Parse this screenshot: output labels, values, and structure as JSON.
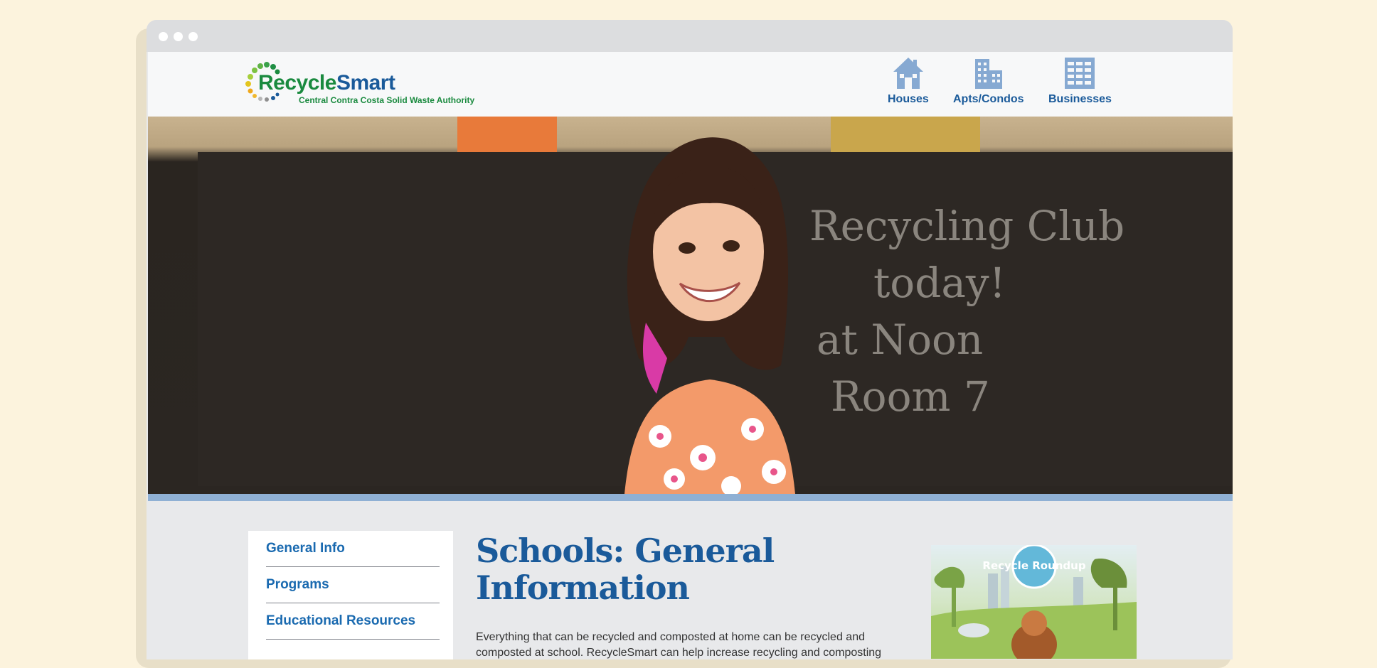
{
  "logo": {
    "word_green": "Recycle",
    "word_blue": "Smart",
    "subtitle": "Central Contra Costa Solid Waste Authority"
  },
  "nav": [
    {
      "label": "Houses",
      "icon": "house-icon"
    },
    {
      "label": "Apts/Condos",
      "icon": "apartment-building-icon"
    },
    {
      "label": "Businesses",
      "icon": "office-building-icon"
    }
  ],
  "hero": {
    "chalk_lines": [
      "Recycling Club",
      "today!",
      "at Noon",
      "Room 7"
    ]
  },
  "sidebar": {
    "items": [
      {
        "label": "General Info"
      },
      {
        "label": "Programs"
      },
      {
        "label": "Educational Resources"
      }
    ]
  },
  "main": {
    "title": "Schools: General Information",
    "body": "Everything that can be recycled and composted at home can be recycled and composted at school. RecycleSmart can help increase recycling and composting"
  },
  "promo": {
    "badge": "Recycle Roundup"
  },
  "colors": {
    "brand_blue": "#1a5a9a",
    "brand_green": "#1a8a3f",
    "hero_bar": "#8fb0d4",
    "page_bg": "#fcf3dd"
  }
}
